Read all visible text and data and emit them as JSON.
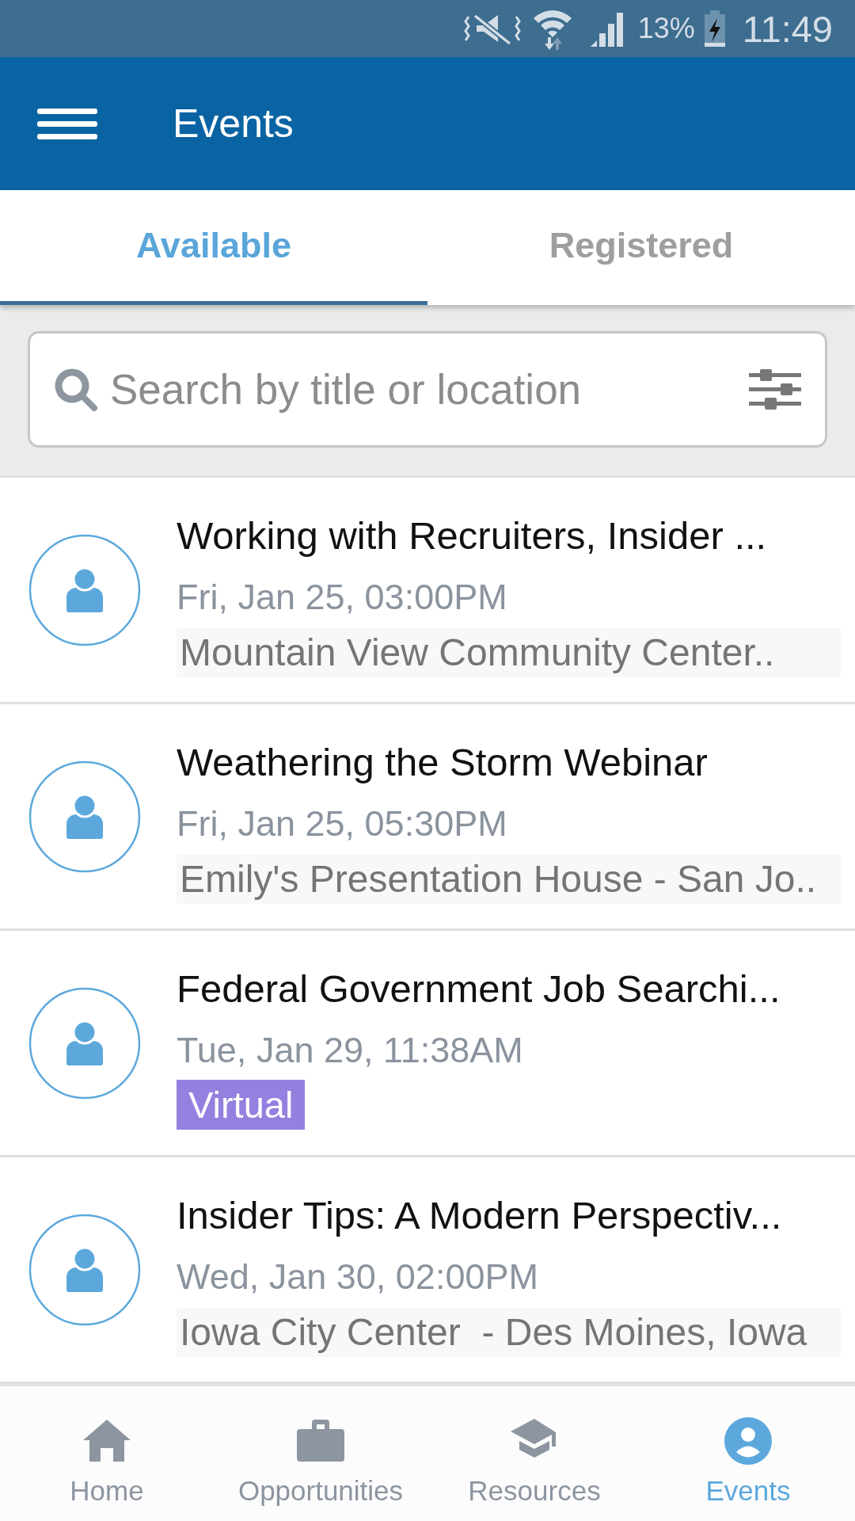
{
  "status_bar": {
    "battery_percent": "13%",
    "time": "11:49"
  },
  "app_bar": {
    "title": "Events"
  },
  "tabs": [
    {
      "label": "Available",
      "selected": true
    },
    {
      "label": "Registered",
      "selected": false
    }
  ],
  "search": {
    "placeholder": "Search by title or location"
  },
  "events": [
    {
      "title": "Working with Recruiters, Insider ...",
      "date": "Fri, Jan 25, 03:00PM",
      "detail": {
        "kind": "location",
        "text": "Mountain View Community Center.."
      }
    },
    {
      "title": "Weathering the Storm Webinar",
      "date": "Fri, Jan 25, 05:30PM",
      "detail": {
        "kind": "location",
        "text": "Emily's Presentation House - San Jo.."
      }
    },
    {
      "title": "Federal Government Job Searchi...",
      "date": "Tue, Jan 29, 11:38AM",
      "detail": {
        "kind": "tag",
        "text": "Virtual"
      }
    },
    {
      "title": "Insider Tips: A Modern Perspectiv...",
      "date": "Wed, Jan 30, 02:00PM",
      "detail": {
        "kind": "location",
        "text": "Iowa City Center  - Des Moines, Iowa"
      }
    }
  ],
  "bottom_nav": [
    {
      "kind": "home",
      "label": "Home",
      "selected": false
    },
    {
      "kind": "briefcase",
      "label": "Opportunities",
      "selected": false
    },
    {
      "kind": "cap",
      "label": "Resources",
      "selected": false
    },
    {
      "kind": "person",
      "label": "Events",
      "selected": true
    }
  ]
}
